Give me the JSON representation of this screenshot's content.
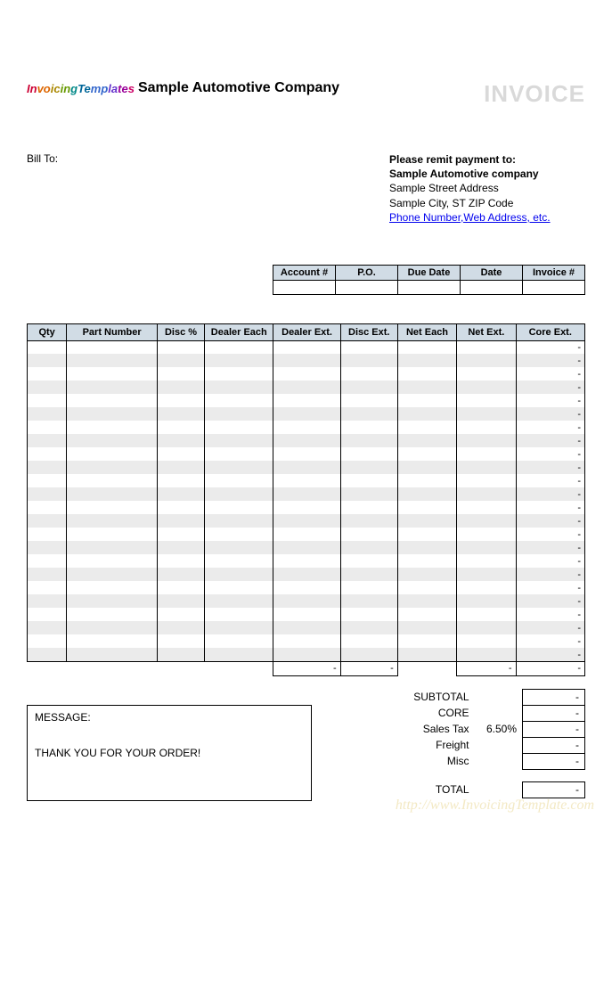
{
  "header": {
    "logo_text": "InvoicingTemplates",
    "company_name": "Sample Automotive Company",
    "doc_title": "INVOICE"
  },
  "billto": {
    "label": "Bill To:"
  },
  "remit": {
    "line1": "Please remit payment to:",
    "line2": "Sample Automotive company",
    "line3": "Sample Street Address",
    "line4": "Sample City, ST  ZIP Code",
    "link": "Phone Number,Web Address, etc."
  },
  "meta": {
    "cols": [
      "Account #",
      "P.O.",
      "Due Date",
      "Date",
      "Invoice #"
    ],
    "vals": [
      "",
      "",
      "",
      "",
      ""
    ]
  },
  "items": {
    "cols": [
      "Qty",
      "Part Number",
      "Disc %",
      "Dealer Each",
      "Dealer Ext.",
      "Disc Ext.",
      "Net Each",
      "Net Ext.",
      "Core Ext."
    ],
    "row_core_ext_display": "-",
    "row_count": 24,
    "col_totals": {
      "dealer_ext": "-",
      "disc_ext": "-",
      "net_ext": "-",
      "core_ext": "-"
    }
  },
  "message": {
    "label": "MESSAGE:",
    "thank_you": "THANK YOU FOR YOUR ORDER!"
  },
  "totals": {
    "subtotal_label": "SUBTOTAL",
    "subtotal_val": "-",
    "core_label": "CORE",
    "core_val": "-",
    "tax_label": "Sales Tax",
    "tax_rate": "6.50%",
    "tax_val": "-",
    "freight_label": "Freight",
    "freight_val": "-",
    "misc_label": "Misc",
    "misc_val": "-",
    "total_label": "TOTAL",
    "total_val": "-"
  },
  "watermark": "http://www.InvoicingTemplate.com"
}
